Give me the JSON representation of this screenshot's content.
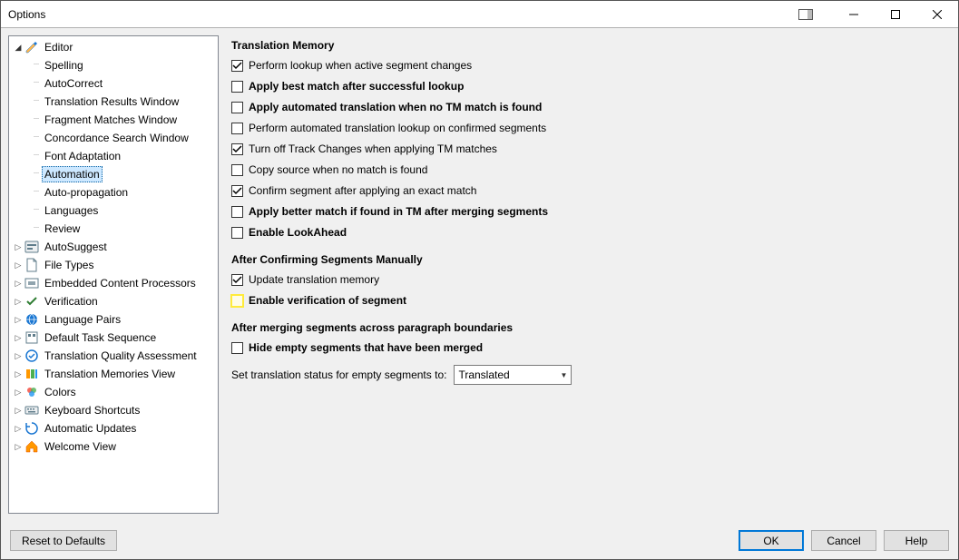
{
  "window": {
    "title": "Options"
  },
  "tree": {
    "editor": {
      "label": "Editor",
      "children": {
        "spelling": "Spelling",
        "autocorrect": "AutoCorrect",
        "transres": "Translation Results Window",
        "fragmatch": "Fragment Matches Window",
        "concord": "Concordance Search Window",
        "fontadapt": "Font Adaptation",
        "automation": "Automation",
        "autoprop": "Auto-propagation",
        "languages": "Languages",
        "review": "Review"
      }
    },
    "autosuggest": "AutoSuggest",
    "filetypes": "File Types",
    "embedded": "Embedded Content Processors",
    "verification": "Verification",
    "langpairs": "Language Pairs",
    "defaulttask": "Default Task Sequence",
    "tqa": "Translation Quality Assessment",
    "tmview": "Translation Memories View",
    "colors": "Colors",
    "keyboard": "Keyboard Shortcuts",
    "autoupd": "Automatic Updates",
    "welcome": "Welcome View"
  },
  "panel": {
    "tm_header": "Translation Memory",
    "o1": "Perform lookup when active segment changes",
    "o2": "Apply best match after successful lookup",
    "o3": "Apply automated translation when no TM match is found",
    "o4": "Perform automated translation lookup on confirmed segments",
    "o5": "Turn off Track Changes when applying TM matches",
    "o6": "Copy source when no match is found",
    "o7": "Confirm segment after applying an exact match",
    "o8": "Apply better match if found in TM after merging segments",
    "o9": "Enable LookAhead",
    "acs_header": "After Confirming Segments Manually",
    "o10": "Update translation memory",
    "o11": "Enable verification of segment",
    "merge_header": "After merging segments across paragraph boundaries",
    "o12": "Hide empty segments that have been merged",
    "status_label": "Set translation status for empty segments to:",
    "status_value": "Translated"
  },
  "buttons": {
    "reset": "Reset to Defaults",
    "ok": "OK",
    "cancel": "Cancel",
    "help": "Help"
  }
}
